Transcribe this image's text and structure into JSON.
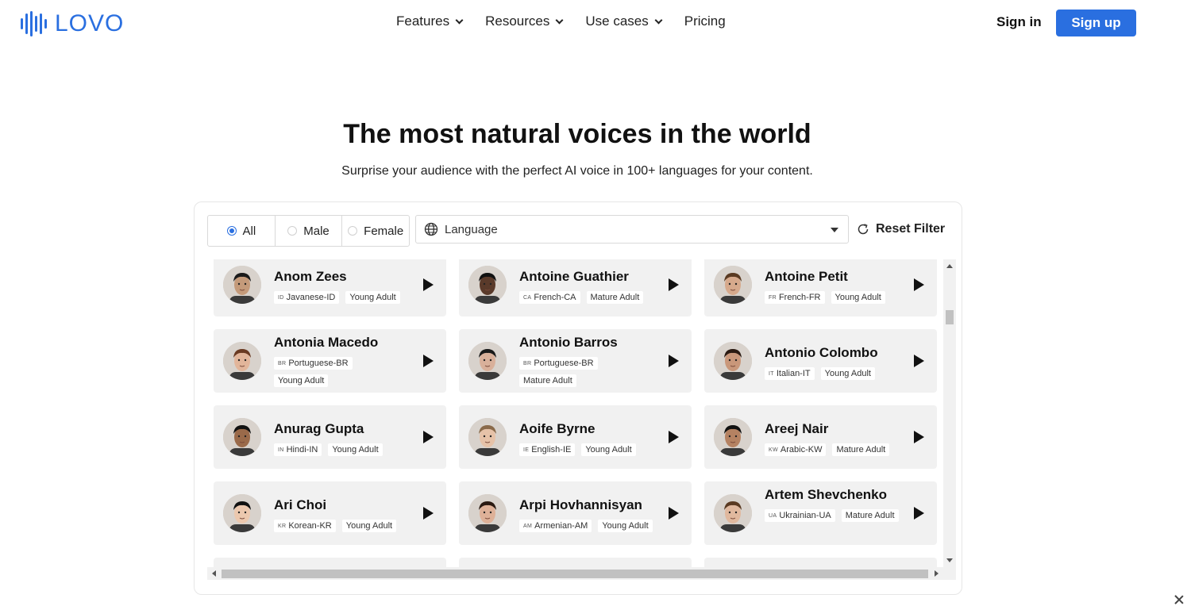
{
  "brand": {
    "name": "LOVO",
    "color": "#2a6fe0"
  },
  "nav": {
    "items": [
      {
        "label": "Features",
        "dropdown": true
      },
      {
        "label": "Resources",
        "dropdown": true
      },
      {
        "label": "Use cases",
        "dropdown": true
      },
      {
        "label": "Pricing",
        "dropdown": false
      }
    ],
    "signin_label": "Sign in",
    "signup_label": "Sign up"
  },
  "hero": {
    "title": "The most natural voices in the world",
    "subtitle": "Surprise your audience with the perfect AI voice in 100+ languages for your content."
  },
  "filters": {
    "gender": [
      {
        "label": "All",
        "selected": true
      },
      {
        "label": "Male",
        "selected": false
      },
      {
        "label": "Female",
        "selected": false
      }
    ],
    "language_placeholder": "Language",
    "reset_label": "Reset Filter"
  },
  "voices": [
    {
      "name": "Anom Zees",
      "cc": "ID",
      "lang": "Javanese-ID",
      "age": "Young Adult",
      "skin": "#c49a7a",
      "hair": "#1a1a1a"
    },
    {
      "name": "Antoine Guathier",
      "cc": "CA",
      "lang": "French-CA",
      "age": "Mature Adult",
      "skin": "#5a3a2a",
      "hair": "#111111"
    },
    {
      "name": "Antoine Petit",
      "cc": "FR",
      "lang": "French-FR",
      "age": "Young Adult",
      "skin": "#d6a98c",
      "hair": "#5a3a22"
    },
    {
      "name": "Antonia Macedo",
      "cc": "BR",
      "lang": "Portuguese-BR",
      "age": "Young Adult",
      "skin": "#e2b59a",
      "hair": "#6a3a22"
    },
    {
      "name": "Antonio Barros",
      "cc": "BR",
      "lang": "Portuguese-BR",
      "age": "Mature Adult",
      "skin": "#d9b09a",
      "hair": "#1a1a1a"
    },
    {
      "name": "Antonio Colombo",
      "cc": "IT",
      "lang": "Italian-IT",
      "age": "Young Adult",
      "skin": "#c9977a",
      "hair": "#2a1a12"
    },
    {
      "name": "Anurag Gupta",
      "cc": "IN",
      "lang": "Hindi-IN",
      "age": "Young Adult",
      "skin": "#9a6a4a",
      "hair": "#111111"
    },
    {
      "name": "Aoife Byrne",
      "cc": "IE",
      "lang": "English-IE",
      "age": "Young Adult",
      "skin": "#e6c2a8",
      "hair": "#8a6a4a"
    },
    {
      "name": "Areej Nair",
      "cc": "KW",
      "lang": "Arabic-KW",
      "age": "Mature Adult",
      "skin": "#b58262",
      "hair": "#111111"
    },
    {
      "name": "Ari Choi",
      "cc": "KR",
      "lang": "Korean-KR",
      "age": "Young Adult",
      "skin": "#ecc8ae",
      "hair": "#111111"
    },
    {
      "name": "Arpi Hovhannisyan",
      "cc": "AM",
      "lang": "Armenian-AM",
      "age": "Young Adult",
      "skin": "#deb198",
      "hair": "#2a1a12"
    },
    {
      "name": "Artem Shevchenko",
      "cc": "UA",
      "lang": "Ukrainian-UA",
      "age": "Mature Adult",
      "skin": "#e0b89e",
      "hair": "#5a3a22"
    },
    {
      "name": "",
      "cc": "",
      "lang": "",
      "age": "",
      "skin": "#2a2a2a",
      "hair": "#111111"
    },
    {
      "name": "",
      "cc": "",
      "lang": "",
      "age": "",
      "skin": "#2a2a2a",
      "hair": "#111111"
    },
    {
      "name": "",
      "cc": "",
      "lang": "",
      "age": "",
      "skin": "#2a2a2a",
      "hair": "#111111"
    }
  ]
}
